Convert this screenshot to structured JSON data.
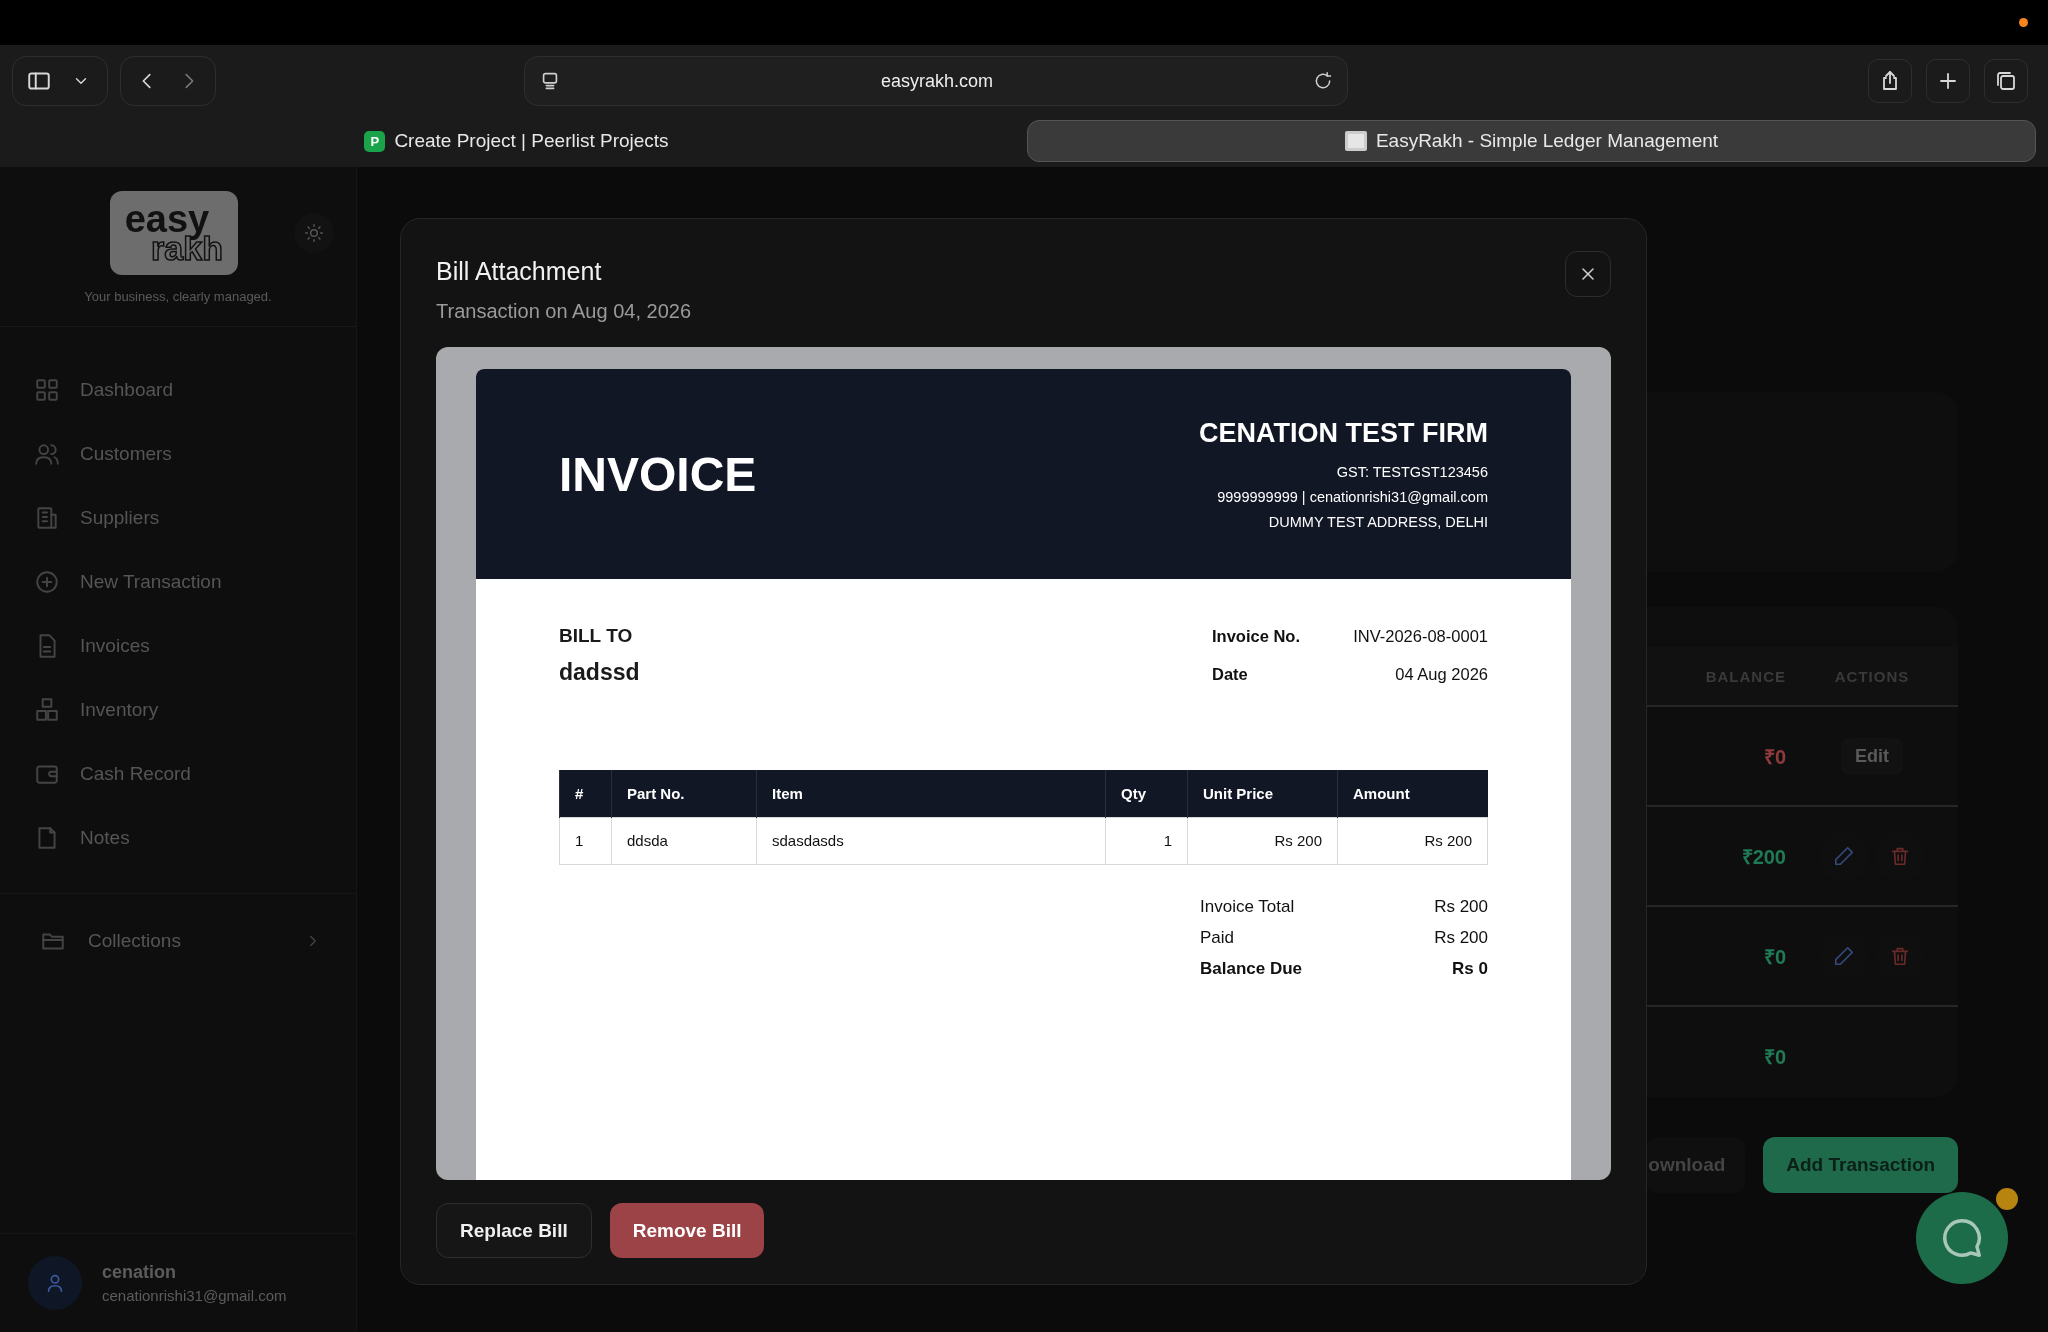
{
  "browser": {
    "url": "easyrakh.com",
    "tabs": [
      {
        "label": "Create Project | Peerlist Projects",
        "favicon": "P",
        "selected": false
      },
      {
        "label": "EasyRakh - Simple Ledger Management",
        "selected": true
      }
    ]
  },
  "sidebar": {
    "logo": {
      "line1": "easy",
      "line2": "rakh"
    },
    "tagline": "Your business, clearly managed.",
    "items": [
      {
        "label": "Dashboard"
      },
      {
        "label": "Customers"
      },
      {
        "label": "Suppliers"
      },
      {
        "label": "New Transaction"
      },
      {
        "label": "Invoices"
      },
      {
        "label": "Inventory"
      },
      {
        "label": "Cash Record"
      },
      {
        "label": "Notes"
      }
    ],
    "collections": "Collections",
    "user": {
      "name": "cenation",
      "email": "cenationrishi31@gmail.com"
    }
  },
  "background_table": {
    "columns": [
      "BALANCE",
      "ACTIONS"
    ],
    "rows": [
      {
        "balance": "₹0",
        "color": "#8f3b3b",
        "kind": "edit",
        "action": "Edit"
      },
      {
        "balance": "₹200",
        "color": "#1f7a55",
        "kind": "icons"
      },
      {
        "balance": "₹0",
        "color": "#1f7a55",
        "kind": "icons"
      },
      {
        "balance": "₹0",
        "color": "#1f7a55",
        "kind": "none"
      }
    ]
  },
  "background_buttons": [
    {
      "label": "ownload",
      "kind": "secondary"
    },
    {
      "label": "Add Transaction",
      "kind": "primary"
    }
  ],
  "modal": {
    "title": "Bill Attachment",
    "subtitle": "Transaction on Aug 04, 2026",
    "invoice": {
      "title": "INVOICE",
      "firm": "CENATION TEST FIRM",
      "firm_lines": [
        "GST: TESTGST123456",
        "9999999999 | cenationrishi31@gmail.com",
        "DUMMY TEST ADDRESS, DELHI"
      ],
      "bill_to_label": "BILL TO",
      "customer": "dadssd",
      "meta": [
        {
          "label": "Invoice No.",
          "value": "INV-2026-08-0001"
        },
        {
          "label": "Date",
          "value": "04 Aug 2026"
        }
      ],
      "columns": [
        "#",
        "Part No.",
        "Item",
        "Qty",
        "Unit Price",
        "Amount"
      ],
      "rows": [
        [
          "1",
          "ddsda",
          "sdasdasds",
          "1",
          "Rs 200",
          "Rs 200"
        ]
      ],
      "totals": [
        {
          "label": "Invoice Total",
          "value": "Rs 200",
          "emphasis": false
        },
        {
          "label": "Paid",
          "value": "Rs 200",
          "emphasis": false
        },
        {
          "label": "Balance Due",
          "value": "Rs 0",
          "emphasis": true
        }
      ]
    },
    "buttons": [
      {
        "label": "Replace Bill",
        "kind": "secondary"
      },
      {
        "label": "Remove Bill",
        "kind": "danger"
      }
    ]
  }
}
